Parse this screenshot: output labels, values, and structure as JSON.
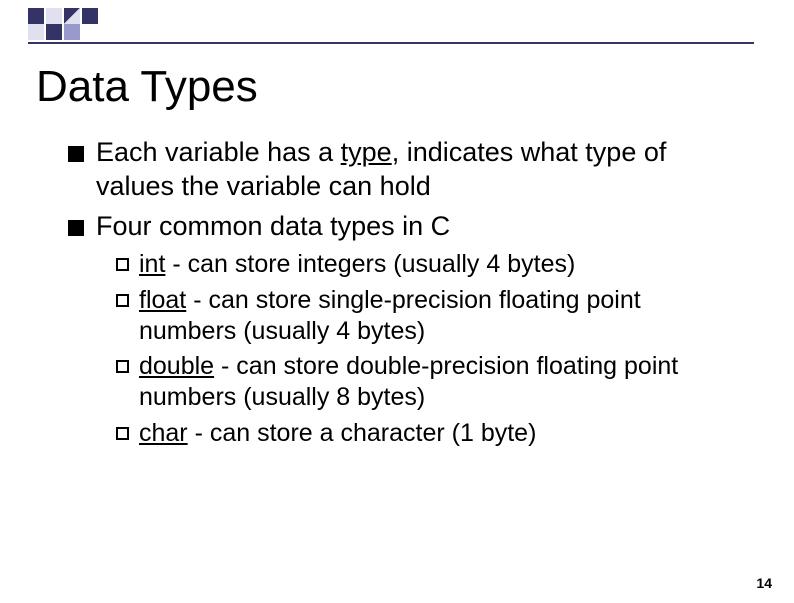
{
  "title": "Data Types",
  "bullets": [
    {
      "pre": "Each variable has a ",
      "u": "type",
      "post": ", indicates what type of values the variable can hold"
    },
    {
      "text": "Four common data types in C"
    }
  ],
  "sub_bullets": [
    {
      "kw": "int",
      "desc": " -   can store integers (usually 4 bytes)"
    },
    {
      "kw": "float",
      "desc": "  -  can store single-precision floating point numbers (usually 4 bytes)"
    },
    {
      "kw": "double",
      "desc": " - can store double-precision floating point numbers (usually 8 bytes)"
    },
    {
      "kw": "char",
      "desc": " - can store a character (1 byte)"
    }
  ],
  "page_number": "14"
}
